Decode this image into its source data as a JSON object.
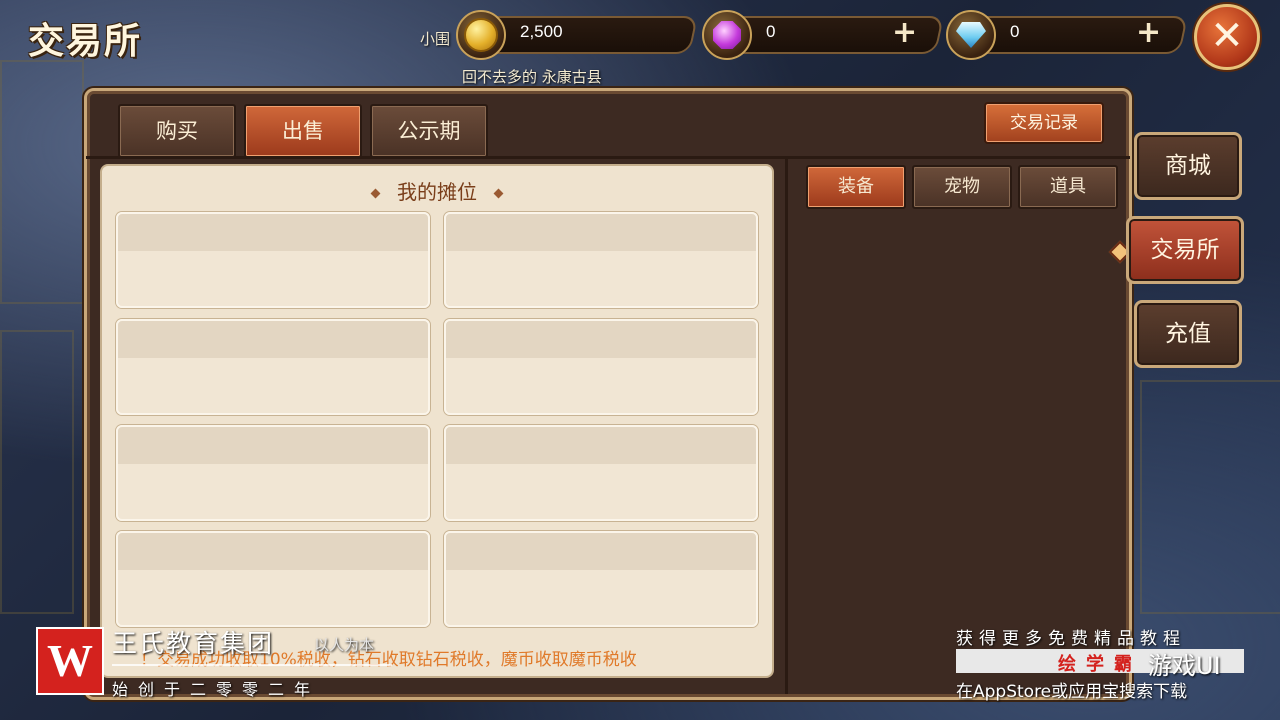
{
  "title": "交易所",
  "npc": {
    "left_name": "小围",
    "caption": "回不去多的  永康古县"
  },
  "currency": [
    {
      "icon": "gold-coin-icon",
      "value": "2,500"
    },
    {
      "icon": "purple-gem-icon",
      "value": "0"
    },
    {
      "icon": "diamond-icon",
      "value": "0"
    }
  ],
  "plus": "+",
  "close": "✕",
  "tabs": [
    "购买",
    "出售",
    "公示期"
  ],
  "active_tab": "出售",
  "records_button": "交易记录",
  "stall_title": "我的摊位",
  "categories": [
    "装备",
    "宠物",
    "道具"
  ],
  "active_category": "装备",
  "notice": "！交易成功收取10%税收，钻石收取钻石税收，魔币收取魔币税收",
  "side_nav": [
    "商城",
    "交易所",
    "充值"
  ],
  "active_side": "交易所",
  "watermark": {
    "logo": "W",
    "name": "王氏教育集团",
    "motto": "以人为本",
    "since": "始创于二零零二年",
    "right_line1": "获得更多免费精品教程",
    "right_brand": "绘学霸",
    "right_ui": "游戏UI",
    "right_line3": "在AppStore或应用宝搜索下载"
  },
  "colors": {
    "accent": "#c0532f",
    "panel": "#3d2a22",
    "slot": "#efe3cf"
  }
}
